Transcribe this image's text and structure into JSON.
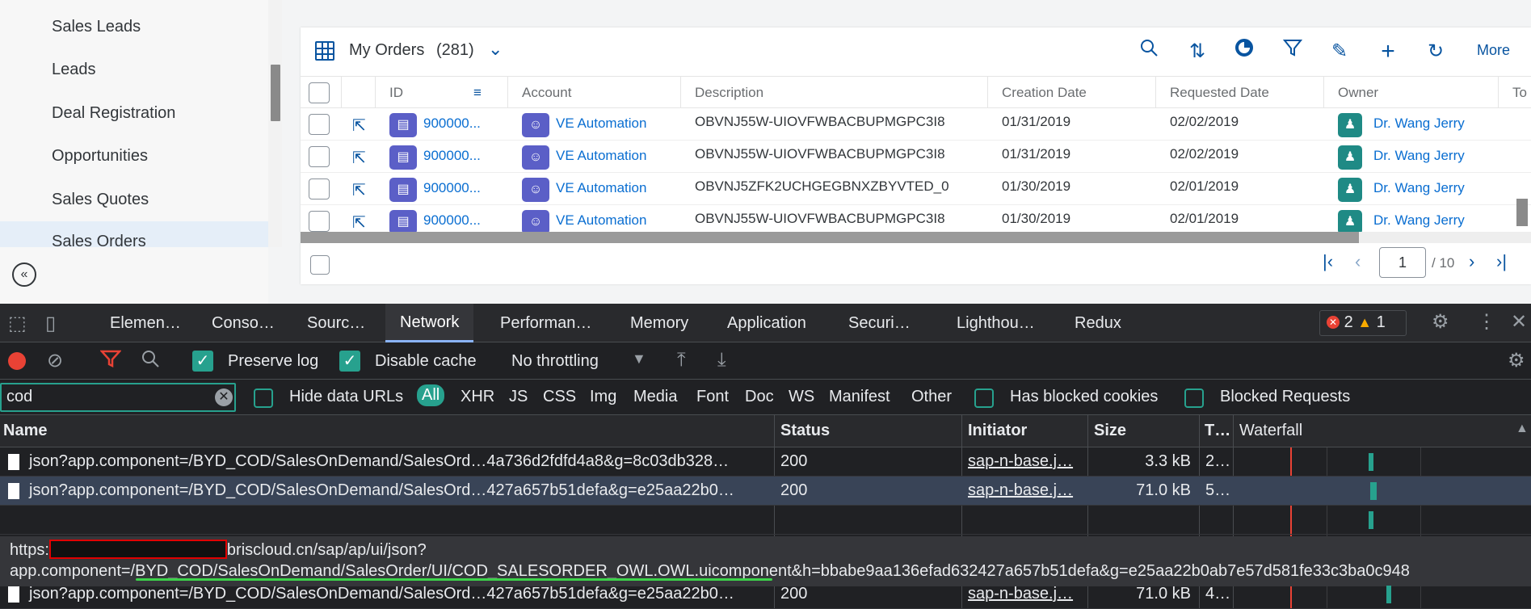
{
  "sidebar": {
    "items": [
      "Sales Leads",
      "Leads",
      "Deal Registration",
      "Opportunities",
      "Sales Quotes",
      "Sales Orders"
    ],
    "collapse_icon": "double-chevron-left-icon"
  },
  "panel": {
    "title": "My Orders",
    "count": "(281)",
    "more_label": "More",
    "tools": [
      "search-icon",
      "sort-icon",
      "group-icon",
      "filter-icon",
      "edit-icon",
      "add-icon",
      "refresh-icon"
    ]
  },
  "table": {
    "columns": [
      "ID",
      "Account",
      "Description",
      "Creation Date",
      "Requested Date",
      "Owner",
      "To"
    ],
    "rows": [
      {
        "id": "900000...",
        "account": "VE Automation",
        "description": "OBVNJ55W-UIOVFWBACBUPMGPC3I8",
        "creation": "01/31/2019",
        "requested": "02/02/2019",
        "owner": "Dr. Wang Jerry"
      },
      {
        "id": "900000...",
        "account": "VE Automation",
        "description": "OBVNJ55W-UIOVFWBACBUPMGPC3I8",
        "creation": "01/31/2019",
        "requested": "02/02/2019",
        "owner": "Dr. Wang Jerry"
      },
      {
        "id": "900000...",
        "account": "VE Automation",
        "description": "OBVNJ5ZFK2UCHGEGBNXZBYVTED_0",
        "creation": "01/30/2019",
        "requested": "02/01/2019",
        "owner": "Dr. Wang Jerry"
      },
      {
        "id": "900000...",
        "account": "VE Automation",
        "description": "OBVNJ55W-UIOVFWBACBUPMGPC3I8",
        "creation": "01/30/2019",
        "requested": "02/01/2019",
        "owner": "Dr. Wang Jerry"
      }
    ]
  },
  "pager": {
    "page": "1",
    "total": "/ 10"
  },
  "devtools": {
    "tabs": [
      "Elemen…",
      "Conso…",
      "Sourc…",
      "Network",
      "Performan…",
      "Memory",
      "Application",
      "Securi…",
      "Lighthou…",
      "Redux"
    ],
    "errors": "2",
    "warnings": "1",
    "preserve_log": "Preserve log",
    "disable_cache": "Disable cache",
    "throttling": "No throttling",
    "filter_value": "cod",
    "hide_data_urls": "Hide data URLs",
    "types": [
      "All",
      "XHR",
      "JS",
      "CSS",
      "Img",
      "Media",
      "Font",
      "Doc",
      "WS",
      "Manifest",
      "Other"
    ],
    "has_blocked_cookies": "Has blocked cookies",
    "blocked_requests": "Blocked Requests",
    "net_columns": [
      "Name",
      "Status",
      "Initiator",
      "Size",
      "T…",
      "Waterfall"
    ],
    "net_rows": [
      {
        "name": "json?app.component=/BYD_COD/SalesOnDemand/SalesOrd…4a736d2fdfd4a8&g=8c03db328…",
        "status": "200",
        "initiator": "sap-n-base.j…",
        "size": "3.3 kB",
        "time": "2…"
      },
      {
        "name": "json?app.component=/BYD_COD/SalesOnDemand/SalesOrd…427a657b51defa&g=e25aa22b0…",
        "status": "200",
        "initiator": "sap-n-base.j…",
        "size": "71.0 kB",
        "time": "5…"
      },
      {
        "name": "json?app.component=/BYD_COD/SalesOnDemand/SalesOrd…427a657b51defa&g=e25aa22b0…",
        "status": "200",
        "initiator": "sap-n-base.j…",
        "size": "71.0 kB",
        "time": "4…"
      }
    ],
    "tooltip_line1_prefix": "https:",
    "tooltip_line1_suffix": "briscloud.cn/sap/ap/ui/json?",
    "tooltip_line2": "app.component=/BYD_COD/SalesOnDemand/SalesOrder/UI/COD_SALESORDER_OWL.OWL.uicomponent&h=bbabe9aa136efad632427a657b51defa&g=e25aa22b0ab7e57d581fe33c3ba0c948"
  }
}
